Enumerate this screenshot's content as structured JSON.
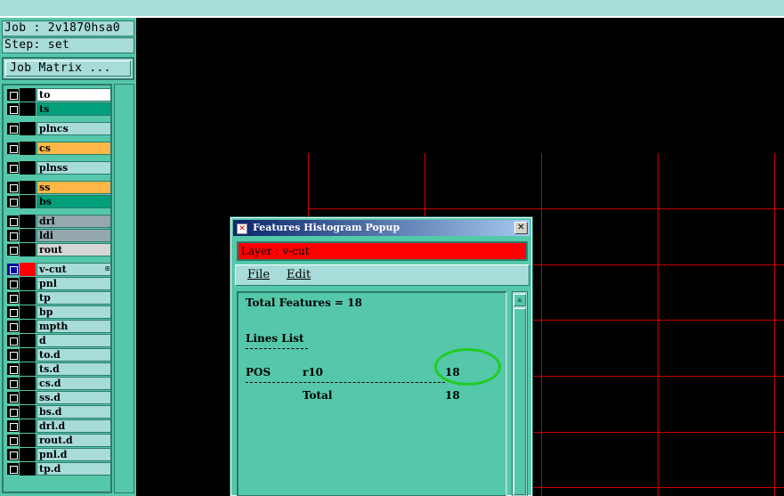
{
  "job": {
    "label": "Job : 2v1870hsa0"
  },
  "step": {
    "label": "Step: set"
  },
  "job_matrix": {
    "label": "Job Matrix ..."
  },
  "layers": [
    {
      "name": "to",
      "bg": "#ffffff"
    },
    {
      "name": "ts",
      "bg": "#00a07a"
    },
    {
      "name": "plncs",
      "bg": "#a7dcd8"
    },
    {
      "name": "cs",
      "bg": "#ffb848"
    },
    {
      "name": "plnss",
      "bg": "#a7dcd8"
    },
    {
      "name": "ss",
      "bg": "#ffb848"
    },
    {
      "name": "bs",
      "bg": "#00a07a"
    },
    {
      "name": "drl",
      "bg": "#94a8ae"
    },
    {
      "name": "ldi",
      "bg": "#94a8ae"
    },
    {
      "name": "rout",
      "bg": "#d6d6d6"
    },
    {
      "name": "v-cut",
      "bg": "#a7dcd8",
      "mark": "⊞",
      "active": true,
      "swatch": "#ff0000",
      "chk": "#0000a0"
    },
    {
      "name": "pnl",
      "bg": "#a7dcd8"
    },
    {
      "name": "tp",
      "bg": "#a7dcd8"
    },
    {
      "name": "bp",
      "bg": "#a7dcd8"
    },
    {
      "name": "mpth",
      "bg": "#a7dcd8"
    },
    {
      "name": "d",
      "bg": "#a7dcd8"
    },
    {
      "name": "to.d",
      "bg": "#a7dcd8"
    },
    {
      "name": "ts.d",
      "bg": "#a7dcd8"
    },
    {
      "name": "cs.d",
      "bg": "#a7dcd8"
    },
    {
      "name": "ss.d",
      "bg": "#a7dcd8"
    },
    {
      "name": "bs.d",
      "bg": "#a7dcd8"
    },
    {
      "name": "drl.d",
      "bg": "#a7dcd8"
    },
    {
      "name": "rout.d",
      "bg": "#a7dcd8"
    },
    {
      "name": "pnl.d",
      "bg": "#a7dcd8"
    },
    {
      "name": "tp.d",
      "bg": "#a7dcd8"
    }
  ],
  "popup": {
    "title": "Features Histogram Popup",
    "close_icon": "close-icon",
    "layer_label": "Layer :  v-cut",
    "menu": {
      "file": "File",
      "edit": "Edit"
    },
    "report": {
      "total_features": "Total Features = 18",
      "section_title": "Lines List",
      "row_type": "POS",
      "row_symbol": "r10",
      "row_count": "18",
      "total_label": "Total",
      "total_value": "18"
    }
  },
  "colors": {
    "panel": "#55c8aa",
    "panel_light": "#a7dcd8",
    "canvas": "#000000",
    "grid": "#c80000",
    "layer_bar": "#ff0000",
    "highlight": "#22cc22"
  }
}
